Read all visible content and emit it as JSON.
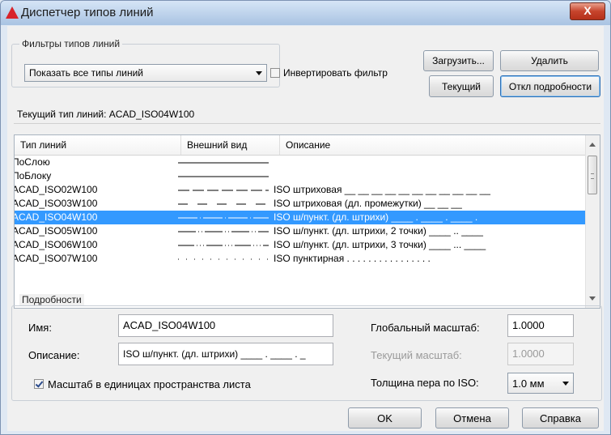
{
  "window": {
    "title": "Диспетчер типов линий",
    "close_label": "X"
  },
  "filters": {
    "group_label": "Фильтры типов линий",
    "selected_filter": "Показать все типы линий",
    "invert_label": "Инвертировать фильтр",
    "invert_checked": false
  },
  "buttons": {
    "load": "Загрузить...",
    "delete": "Удалить",
    "current": "Текущий",
    "hide_details": "Откл подробности",
    "ok": "OK",
    "cancel": "Отмена",
    "help": "Справка"
  },
  "current_linetype": {
    "label": "Текущий тип линий:",
    "value": "ACAD_ISO04W100"
  },
  "list": {
    "headers": [
      "Тип линий",
      "Внешний вид",
      "Описание"
    ],
    "rows": [
      {
        "name": "ПоСлою",
        "pattern": "continuous",
        "description": "",
        "selected": false
      },
      {
        "name": "ПоБлоку",
        "pattern": "continuous",
        "description": "",
        "selected": false
      },
      {
        "name": "ACAD_ISO02W100",
        "pattern": "dashed",
        "description": "ISO штриховая __ __ __ __ __ __ __ __ __ __ __",
        "selected": false
      },
      {
        "name": "ACAD_ISO03W100",
        "pattern": "dashed-space",
        "description": "ISO штриховая (дл. промежутки) __ __ __",
        "selected": false
      },
      {
        "name": "ACAD_ISO04W100",
        "pattern": "dashdot",
        "description": "ISO ш/пункт. (дл. штрихи) ____ . ____ . ____ .",
        "selected": true
      },
      {
        "name": "ACAD_ISO05W100",
        "pattern": "dash2dot",
        "description": "ISO ш/пункт. (дл. штрихи, 2 точки) ____ .. ____",
        "selected": false
      },
      {
        "name": "ACAD_ISO06W100",
        "pattern": "dash3dot",
        "description": "ISO ш/пункт. (дл. штрихи, 3 точки) ____ ... ____",
        "selected": false
      },
      {
        "name": "ACAD_ISO07W100",
        "pattern": "dotted",
        "description": "ISO пунктирная . . . . . . . . . . . . . . . .",
        "selected": false
      }
    ]
  },
  "details": {
    "group_label": "Подробности",
    "name_label": "Имя:",
    "name_value": "ACAD_ISO04W100",
    "description_label": "Описание:",
    "description_value": "ISO ш/пункт. (дл. штрихи) ____ . ____ . _",
    "paper_space_label": "Масштаб в единицах пространства листа",
    "paper_space_checked": true,
    "global_scale_label": "Глобальный масштаб:",
    "global_scale_value": "1.0000",
    "current_scale_label": "Текущий масштаб:",
    "current_scale_value": "1.0000",
    "pen_width_label": "Толщина пера по ISO:",
    "pen_width_value": "1.0 мм"
  },
  "colors": {
    "selection": "#3399ff",
    "title_gradient_top": "#d6e5f6",
    "title_gradient_bottom": "#a9c3e2",
    "close_button": "#c6442c"
  },
  "icons": {
    "app": "autocad-triangle-icon",
    "close": "close-icon",
    "dropdown": "chevron-down-icon",
    "scroll_up": "scroll-up-arrow-icon",
    "scroll_down": "scroll-down-arrow-icon"
  }
}
